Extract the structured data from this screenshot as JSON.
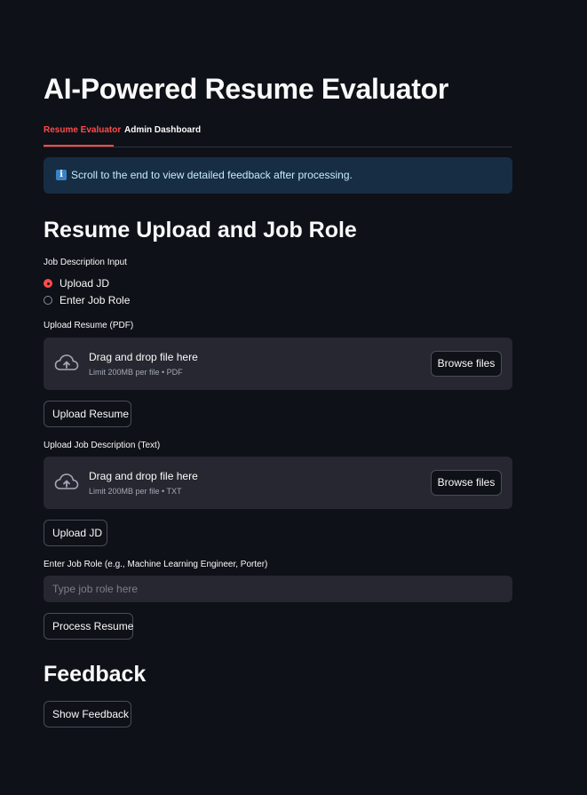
{
  "app": {
    "title": "AI-Powered Resume Evaluator"
  },
  "tabs": [
    {
      "label": "Resume Evaluator",
      "active": true
    },
    {
      "label": "Admin Dashboard",
      "active": false
    }
  ],
  "info": {
    "icon": "info-icon",
    "text": "Scroll to the end to view detailed feedback after processing."
  },
  "upload_section": {
    "heading": "Resume Upload and Job Role",
    "jd_input_label": "Job Description Input",
    "radio_options": [
      {
        "label": "Upload JD",
        "selected": true
      },
      {
        "label": "Enter Job Role",
        "selected": false
      }
    ],
    "resume_uploader": {
      "label": "Upload Resume (PDF)",
      "drop_text": "Drag and drop file here",
      "limit_text": "Limit 200MB per file • PDF",
      "browse_label": "Browse files"
    },
    "upload_resume_button": "Upload Resume",
    "jd_uploader": {
      "label": "Upload Job Description (Text)",
      "drop_text": "Drag and drop file here",
      "limit_text": "Limit 200MB per file • TXT",
      "browse_label": "Browse files"
    },
    "upload_jd_button": "Upload JD",
    "job_role_label": "Enter Job Role (e.g., Machine Learning Engineer, Porter)",
    "job_role_placeholder": "Type job role here",
    "job_role_value": "",
    "process_button": "Process Resume"
  },
  "feedback_section": {
    "heading": "Feedback",
    "show_button": "Show Feedback"
  },
  "colors": {
    "background": "#0e1117",
    "accent": "#ff4b4b",
    "info_bg": "#172d43",
    "widget_bg": "#262730"
  }
}
